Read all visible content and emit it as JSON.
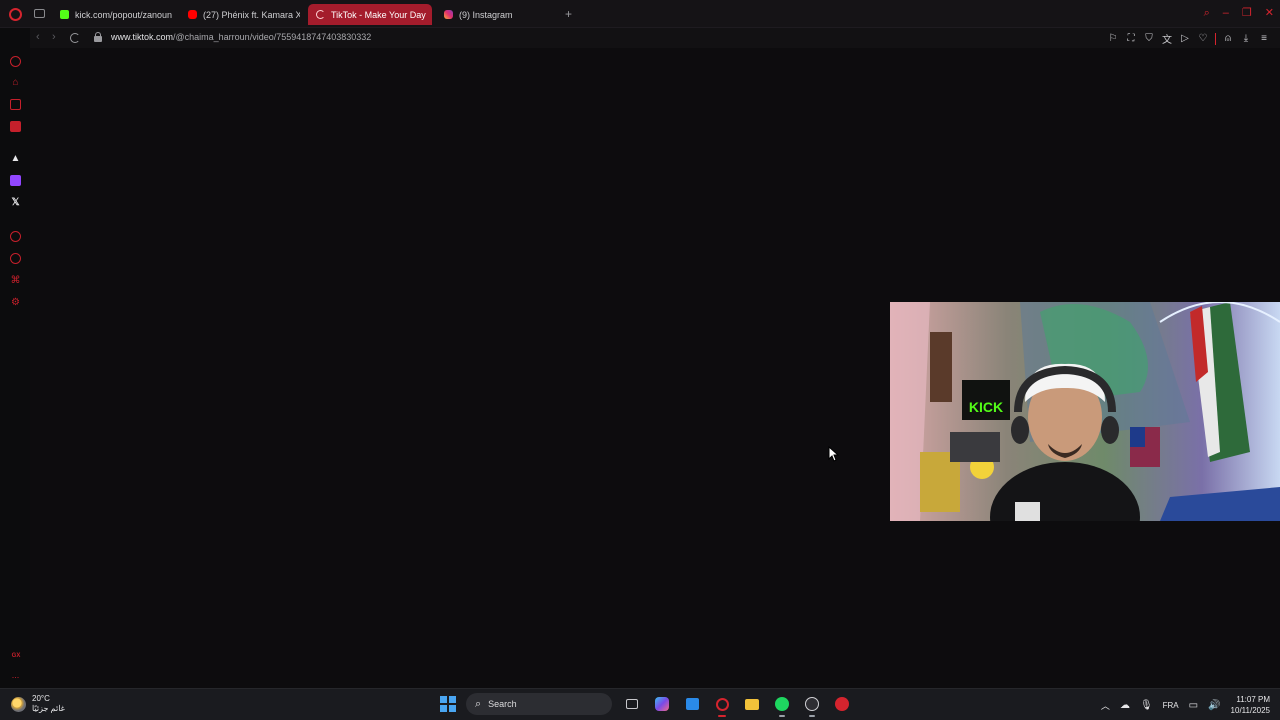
{
  "tabs": [
    {
      "label": "kick.com/popout/zanoun",
      "favicon_color": "#53fc18",
      "active": false
    },
    {
      "label": "(27) Phénix ft. Kamara X",
      "favicon_color": "#ff0000",
      "active": false
    },
    {
      "label": "TikTok - Make Your Day",
      "favicon_color": "#ffffff",
      "active": true
    },
    {
      "label": "(9) Instagram",
      "favicon_color": "#e1306c",
      "active": false
    }
  ],
  "address": {
    "host": "www.tiktok.com",
    "path": "/@chaima_harroun/video/7559418747403830332"
  },
  "sidebar_icons": [
    "opera-icon",
    "extensions-icon",
    "messenger-icon",
    "m-icon",
    "aria-icon",
    "twitch-icon",
    "x-icon",
    "player-icon",
    "history-icon",
    "pinboard-icon",
    "settings-icon",
    "gx-icon",
    "more-icon"
  ],
  "sidebar_gx_label": "GX",
  "sidebar_more_label": "...",
  "taskbar": {
    "temperature": "20°C",
    "weather_desc": "غائم جزئيًا",
    "search_label": "Search",
    "language": "FRA",
    "time": "11:07 PM",
    "date": "10/11/2025"
  },
  "colors": {
    "accent": "#d5242e",
    "background": "#0d0c0e",
    "active_tab": "#a41c2c"
  }
}
